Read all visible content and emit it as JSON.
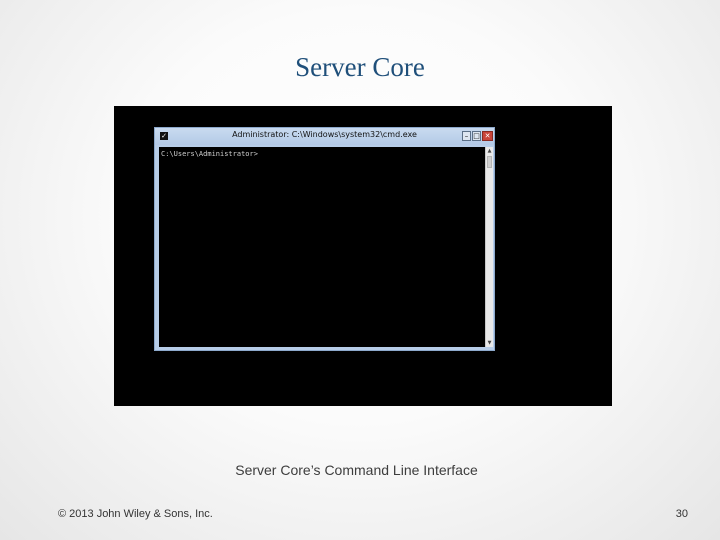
{
  "slide": {
    "title": "Server Core",
    "caption": "Server Core’s Command Line Interface",
    "copyright": "© 2013 John Wiley & Sons, Inc.",
    "page_number": "30"
  },
  "cmd_window": {
    "title": "Administrator: C:\\Windows\\system32\\cmd.exe",
    "prompt": "C:\\Users\\Administrator>",
    "icons": {
      "system": "cmd-system-icon",
      "minimize": "minimize-icon",
      "maximize": "maximize-icon",
      "close": "close-icon",
      "scroll_up": "scroll-up-arrow-icon",
      "scroll_down": "scroll-down-arrow-icon"
    },
    "colors": {
      "titlebar": "#b7cde8",
      "console_bg": "#000000",
      "close_button": "#c9443a"
    }
  },
  "colors": {
    "title": "#1f4f7a",
    "desktop": "#000000"
  }
}
